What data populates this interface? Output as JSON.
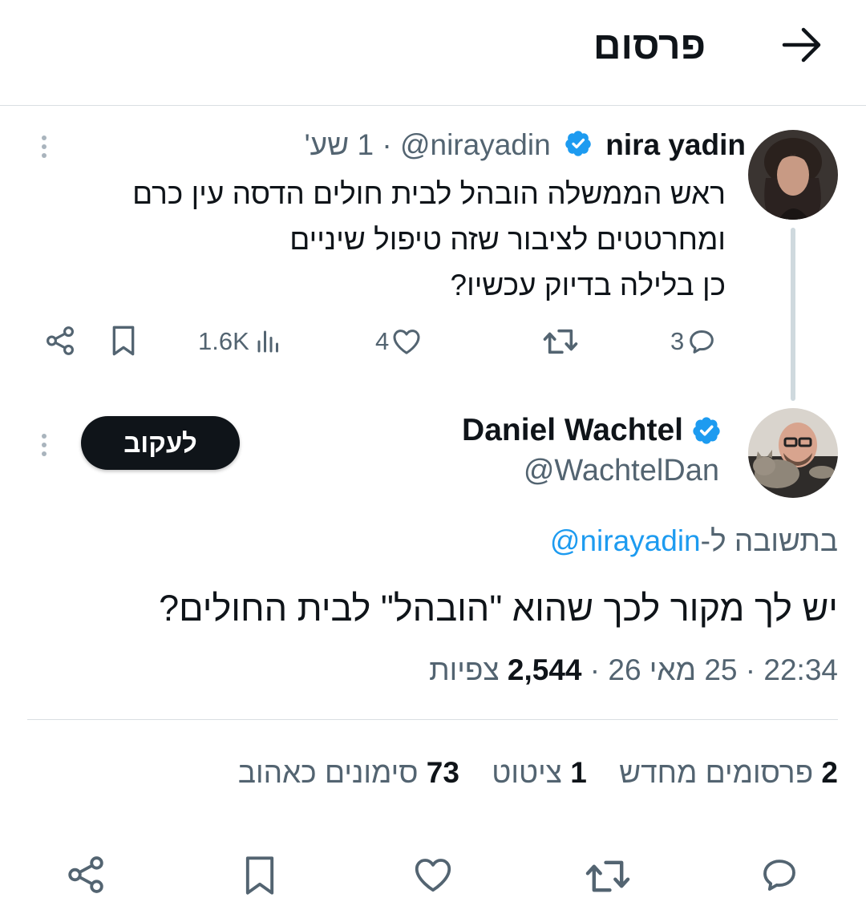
{
  "header": {
    "title": "פרסום",
    "back_icon": "arrow-right-icon"
  },
  "parent_post": {
    "name": "nira yadin",
    "handle": "@nirayadin",
    "time": "· 1 שע'",
    "verified": true,
    "lines": [
      "ראש הממשלה הובהל לבית חולים הדסה עין כרם",
      "ומחרטטים לציבור שזה טיפול שיניים",
      "כן בלילה בדיוק עכשיו?"
    ],
    "actions": {
      "replies": "3",
      "likes": "4",
      "views": "1.6K"
    }
  },
  "main_post": {
    "name": "Daniel Wachtel",
    "handle": "@WachtelDan",
    "verified": true,
    "follow_label": "לעקוב",
    "reply_prefix": "בתשובה ל-",
    "reply_to": "@nirayadin",
    "text": "יש לך מקור לכך שהוא \"הובהל\" לבית החולים?",
    "meta_time": "22:34 · 25 מאי 26 · ",
    "views_count": "2,544",
    "views_label": " צפיות"
  },
  "stats": {
    "reposts_count": "2",
    "reposts_label": " פרסומים מחדש",
    "quotes_count": "1",
    "quotes_label": " ציטוט",
    "likes_count": "73",
    "likes_label": " סימונים כאהוב"
  },
  "colors": {
    "accent": "#1d9bf0",
    "text": "#0f1419",
    "muted": "#536471",
    "divider": "#d9dee2"
  }
}
